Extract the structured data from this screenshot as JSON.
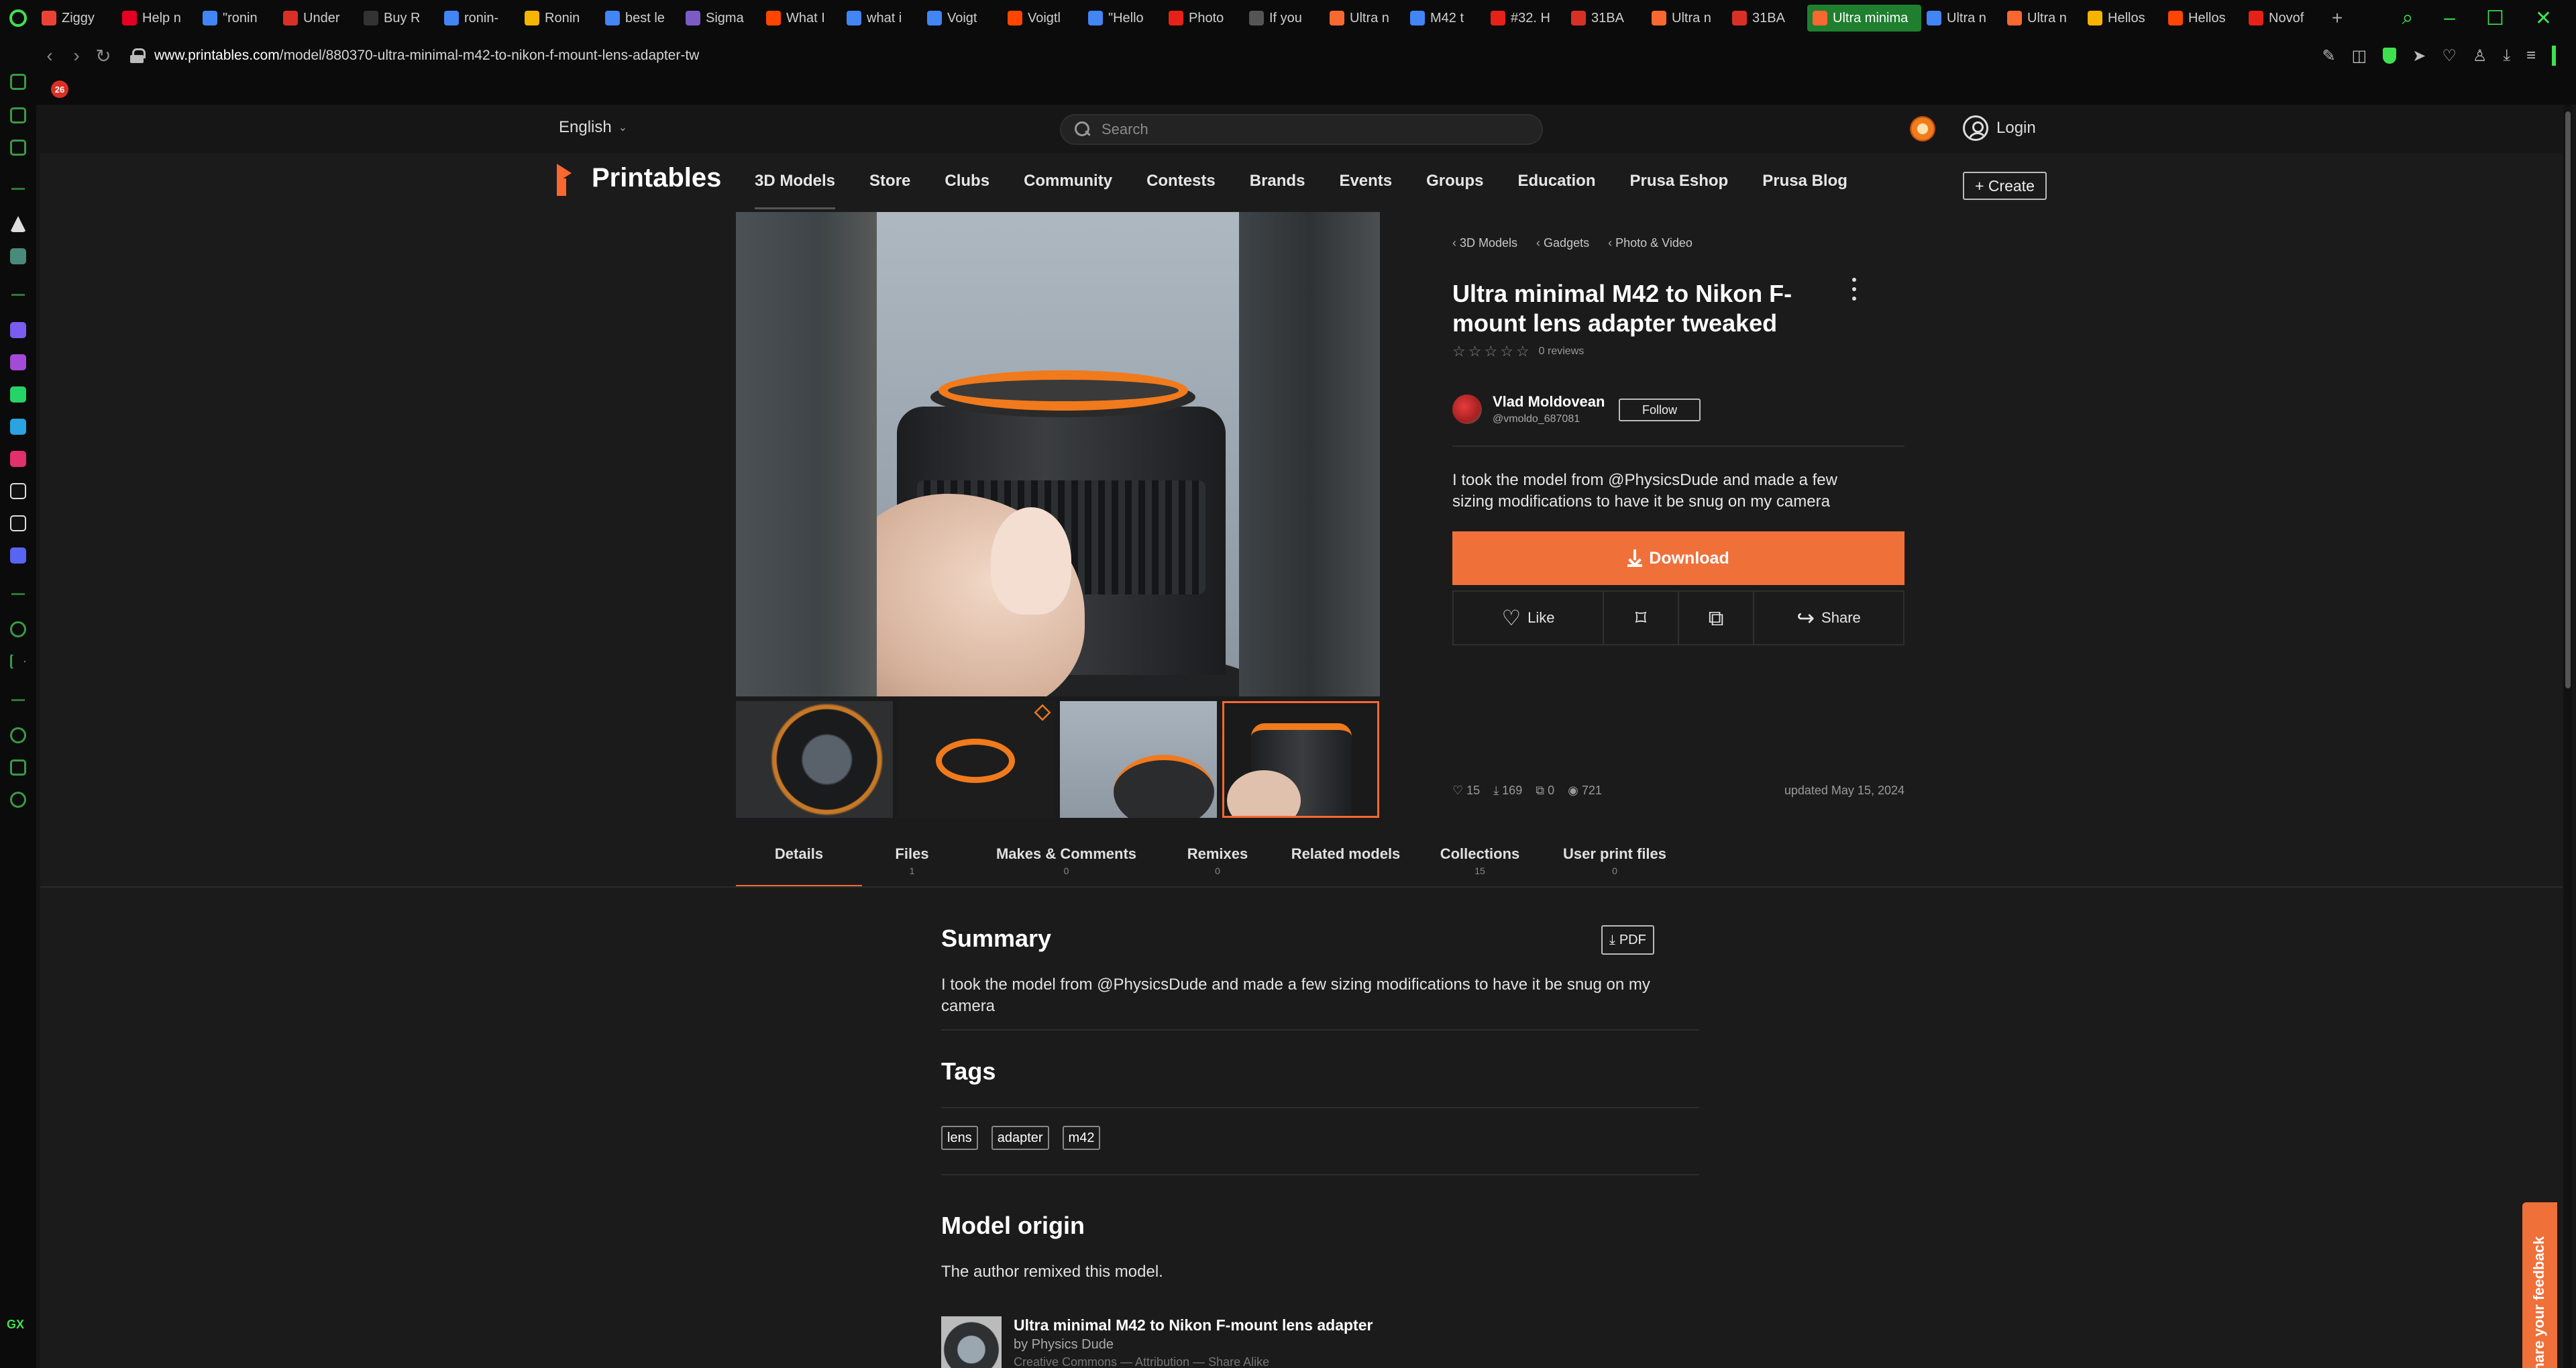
{
  "browser": {
    "tabs": [
      {
        "label": "Ziggy",
        "color": "#ea4335"
      },
      {
        "label": "Help n",
        "color": "#e60023"
      },
      {
        "label": "\"ronin",
        "color": "#4285f4"
      },
      {
        "label": "Under",
        "color": "#d93025"
      },
      {
        "label": "Buy R",
        "color": "#333333"
      },
      {
        "label": "ronin-",
        "color": "#4285f4"
      },
      {
        "label": "Ronin",
        "color": "#f4b400"
      },
      {
        "label": "best le",
        "color": "#4285f4"
      },
      {
        "label": "Sigma",
        "color": "#7c5cc4"
      },
      {
        "label": "What I",
        "color": "#ff4500"
      },
      {
        "label": "what i",
        "color": "#4285f4"
      },
      {
        "label": "Voigt",
        "color": "#4285f4"
      },
      {
        "label": "Voigtl",
        "color": "#ff4500"
      },
      {
        "label": "\"Hello",
        "color": "#4285f4"
      },
      {
        "label": "Photo",
        "color": "#e62117"
      },
      {
        "label": "If you",
        "color": "#555555"
      },
      {
        "label": "Ultra n",
        "color": "#fa6831"
      },
      {
        "label": "M42 t",
        "color": "#4285f4"
      },
      {
        "label": "#32. H",
        "color": "#e62117"
      },
      {
        "label": "31BA",
        "color": "#d93025"
      },
      {
        "label": "Ultra n",
        "color": "#fa6831"
      },
      {
        "label": "31BA",
        "color": "#d93025"
      },
      {
        "label": "Ultra minima",
        "color": "#fa6831",
        "active": true
      },
      {
        "label": "Ultra n",
        "color": "#4285f4"
      },
      {
        "label": "Ultra n",
        "color": "#fa6831"
      },
      {
        "label": "Hellos",
        "color": "#f4b400"
      },
      {
        "label": "Hellos",
        "color": "#ff4500"
      },
      {
        "label": "Novof",
        "color": "#e62117"
      }
    ],
    "url_domain": "www.printables.com",
    "url_path": "/model/880370-ultra-minimal-m42-to-nikon-f-mount-lens-adapter-tw",
    "bookmark_badge": "26"
  },
  "header": {
    "language": "English",
    "search_placeholder": "Search",
    "login_label": "Login"
  },
  "nav": {
    "brand": "Printables",
    "items": [
      "3D Models",
      "Store",
      "Clubs",
      "Community",
      "Contests",
      "Brands",
      "Events",
      "Groups",
      "Education",
      "Prusa Eshop",
      "Prusa Blog"
    ],
    "create_label": "+ Create"
  },
  "model": {
    "breadcrumbs": [
      "3D Models",
      "Gadgets",
      "Photo & Video"
    ],
    "title": "Ultra minimal M42 to Nikon F-mount lens adapter tweaked",
    "reviews": "0 reviews",
    "author_name": "Vlad Moldovean",
    "author_handle": "@vmoldo_687081",
    "follow_label": "Follow",
    "summary": "I took the model from @PhysicsDude and made a few sizing modifications to have it be snug on my camera",
    "download_label": "Download",
    "like_label": "Like",
    "share_label": "Share",
    "stats": {
      "likes": "15",
      "downloads": "169",
      "makes": "0",
      "views": "721"
    },
    "updated": "updated May 15, 2024"
  },
  "detail_tabs": [
    {
      "label": "Details",
      "count": ""
    },
    {
      "label": "Files",
      "count": "1"
    },
    {
      "label": "Makes & Comments",
      "count": "0"
    },
    {
      "label": "Remixes",
      "count": "0"
    },
    {
      "label": "Related models",
      "count": ""
    },
    {
      "label": "Collections",
      "count": "15"
    },
    {
      "label": "User print files",
      "count": "0"
    }
  ],
  "content": {
    "summary_title": "Summary",
    "pdf_label": "PDF",
    "summary_text": "I took the model from @PhysicsDude and made a few sizing modifications to have it be snug on my camera",
    "tags_title": "Tags",
    "tags": [
      "lens",
      "adapter",
      "m42"
    ],
    "origin_title": "Model origin",
    "origin_text": "The author remixed this model.",
    "origin_model_title": "Ultra minimal M42 to Nikon F-mount lens adapter",
    "origin_model_author": "by Physics Dude",
    "origin_model_license": "Creative Commons — Attribution — Share Alike"
  },
  "feedback_label": "Share your feedback"
}
